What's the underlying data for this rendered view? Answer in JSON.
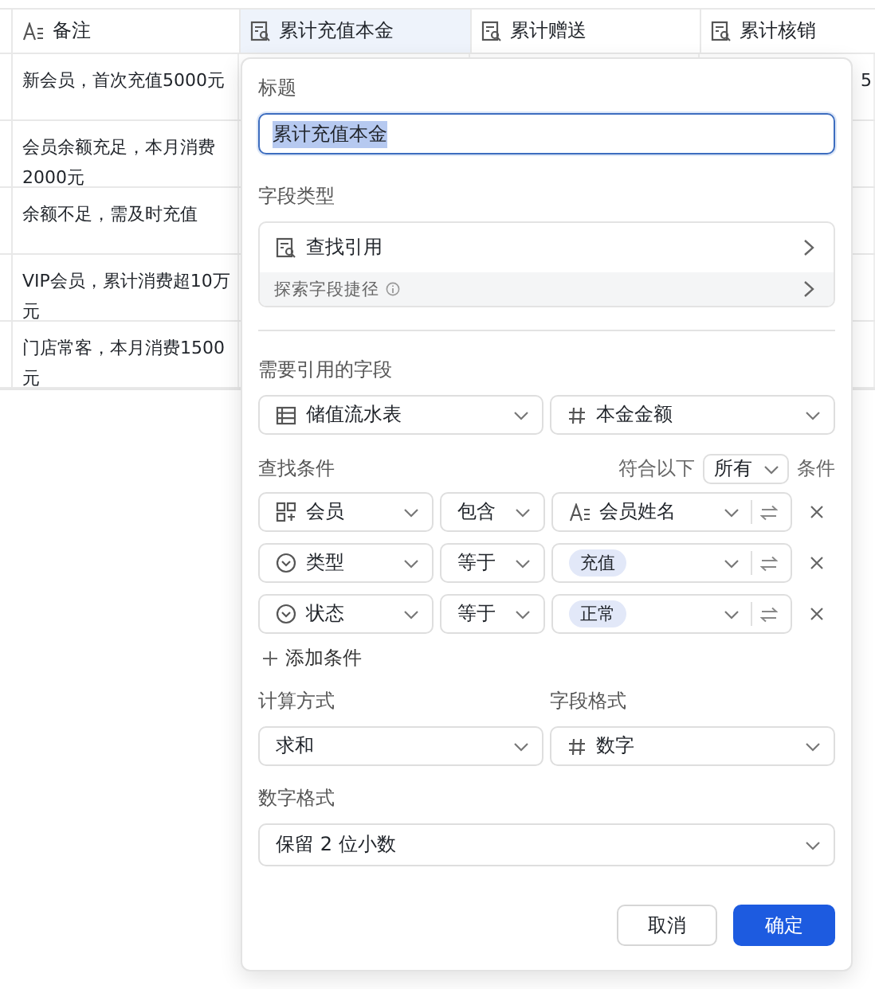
{
  "table": {
    "columns": [
      {
        "label": "备注",
        "kind": "text",
        "selected": false
      },
      {
        "label": "累计充值本金",
        "kind": "lookup",
        "selected": true
      },
      {
        "label": "累计赠送",
        "kind": "lookup",
        "selected": false
      },
      {
        "label": "累计核销",
        "kind": "lookup",
        "selected": false
      }
    ],
    "rows": [
      {
        "cells": [
          "新会员，首次充值5000元",
          "",
          "",
          "5"
        ]
      },
      {
        "cells": [
          "会员余额充足，本月消费2000元",
          "",
          "",
          ""
        ]
      },
      {
        "cells": [
          "余额不足，需及时充值",
          "",
          "",
          ""
        ]
      },
      {
        "cells": [
          "VIP会员，累计消费超10万元",
          "",
          "",
          ""
        ]
      },
      {
        "cells": [
          "门店常客，本月消费1500元",
          "",
          "",
          ""
        ]
      }
    ]
  },
  "dialog": {
    "title_label": "标题",
    "title_value": "累计充值本金",
    "type_label": "字段类型",
    "type_value": "查找引用",
    "explore_link": "探索字段捷径",
    "ref_label": "需要引用的字段",
    "ref_table": "储值流水表",
    "ref_field": "本金金额",
    "cond_label": "查找条件",
    "match_prefix": "符合以下",
    "match_mode": "所有",
    "match_suffix": "条件",
    "conditions": [
      {
        "kind": "link",
        "field": "会员",
        "op": "包含",
        "value": "会员姓名"
      },
      {
        "kind": "option",
        "field": "类型",
        "op": "等于",
        "value": "充值"
      },
      {
        "kind": "option",
        "field": "状态",
        "op": "等于",
        "value": "正常"
      }
    ],
    "add_condition": "添加条件",
    "calc_label": "计算方式",
    "calc_value": "求和",
    "format_label": "字段格式",
    "format_value": "数字",
    "number_label": "数字格式",
    "number_value": "保留 2 位小数",
    "buttons": [
      {
        "label": "取消",
        "kind": "secondary"
      },
      {
        "label": "确定",
        "kind": "primary"
      }
    ]
  }
}
